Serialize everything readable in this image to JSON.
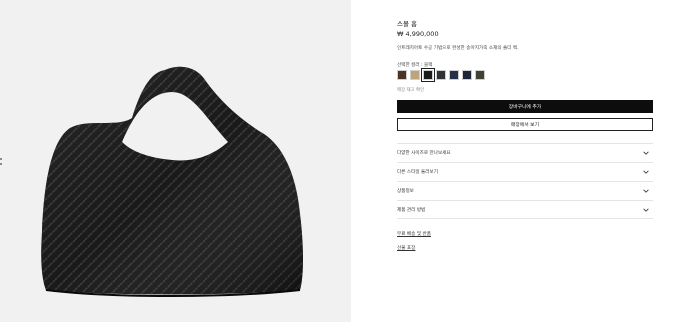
{
  "product": {
    "name": "스몰 홉",
    "price": "₩ 4,990,000",
    "description": "인트레치아토 수공 기법으로 완성한 송아지가죽 소재의 숄더 백."
  },
  "color": {
    "label": "선택한 컬러 : 블랙",
    "swatches": [
      {
        "name": "brown",
        "hex": "#4a3428"
      },
      {
        "name": "tan",
        "hex": "#bfa37a"
      },
      {
        "name": "black",
        "hex": "#1c1c1c",
        "selected": true
      },
      {
        "name": "dark-gray",
        "hex": "#2e3236"
      },
      {
        "name": "navy",
        "hex": "#243049"
      },
      {
        "name": "deep-navy",
        "hex": "#1d2536"
      },
      {
        "name": "olive",
        "hex": "#3d4234"
      }
    ]
  },
  "stock_link": "매장 재고 확인",
  "buttons": {
    "add_to_cart": "장바구니에 추가",
    "view_in_store": "매장에서 보기"
  },
  "accordion": [
    {
      "label": "다양한 사이즈로 만나보세요"
    },
    {
      "label": "다른 스타일 둘러보기"
    },
    {
      "label": "상품정보"
    },
    {
      "label": "제품 관리 방법"
    }
  ],
  "links": {
    "delivery": "무료 배송 및 반품",
    "gift": "선물 포장"
  },
  "icons": {
    "accordion": "chevron-down-icon"
  },
  "colors": {
    "primary_button_bg": "#0d0d0d",
    "image_bg": "#f1f1f1"
  }
}
